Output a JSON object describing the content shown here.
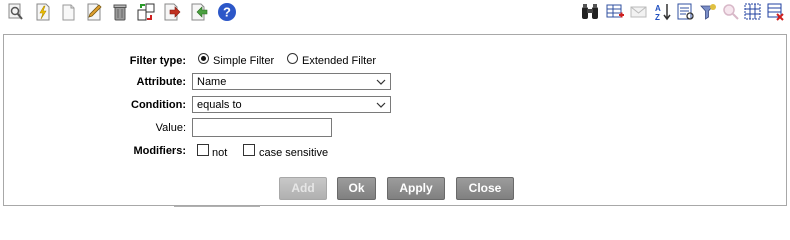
{
  "toolbar": {
    "left_icons": [
      "magnifier-icon",
      "lightning-document-icon",
      "new-document-icon",
      "pencil-icon",
      "trash-can-icon",
      "swap-arrows-icon",
      "export-arrow-icon",
      "import-arrow-icon",
      "help-icon"
    ],
    "right_icons": [
      "binoculars-icon",
      "grid-add-icon",
      "mail-disabled-icon",
      "sort-az-icon",
      "report-icon",
      "clear-filter-icon",
      "zoom-disabled-icon",
      "select-all-icon",
      "delete-table-icon"
    ]
  },
  "filter": {
    "filter_type_label": "Filter type:",
    "simple_filter_label": "Simple Filter",
    "extended_filter_label": "Extended Filter",
    "selected_type": "simple",
    "attribute_label": "Attribute:",
    "attribute_value": "Name",
    "condition_label": "Condition:",
    "condition_value": "equals to",
    "value_label": "Value:",
    "value_input": "",
    "modifiers_label": "Modifiers:",
    "not_label": "not",
    "case_sensitive_label": "case sensitive"
  },
  "buttons": {
    "add_label": "Add",
    "ok_label": "Ok",
    "apply_label": "Apply",
    "close_label": "Close"
  },
  "colors": {
    "button_bg": "#8e8e8e",
    "button_disabled_bg": "#bdbdbd",
    "help_icon_blue": "#2c57c8",
    "panel_border": "#a8a8a8"
  }
}
